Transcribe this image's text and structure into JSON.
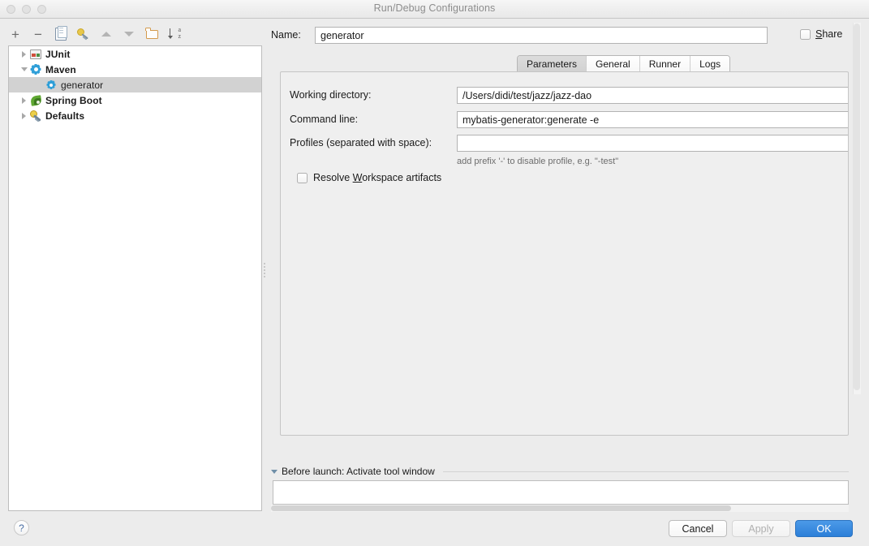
{
  "window": {
    "title": "Run/Debug Configurations"
  },
  "tree_toolbar": {
    "buttons": [
      {
        "name": "add-button",
        "icon": "plus-icon",
        "glyph": "+"
      },
      {
        "name": "remove-button",
        "icon": "minus-icon",
        "glyph": "−"
      },
      {
        "name": "copy-configuration-button",
        "icon": "copy-icon"
      },
      {
        "name": "edit-defaults-button",
        "icon": "wrench-icon"
      },
      {
        "name": "move-up-button",
        "icon": "triangle-up-icon"
      },
      {
        "name": "move-down-button",
        "icon": "triangle-down-icon"
      },
      {
        "name": "new-folder-button",
        "icon": "folder-icon"
      },
      {
        "name": "sort-button",
        "icon": "sort-az-icon"
      }
    ]
  },
  "tree": {
    "items": [
      {
        "label": "JUnit",
        "icon": "junit-icon",
        "expanded": false,
        "selected": false,
        "child": false
      },
      {
        "label": "Maven",
        "icon": "gear-icon",
        "expanded": true,
        "selected": false,
        "child": false
      },
      {
        "label": "generator",
        "icon": "gear-icon",
        "expanded": null,
        "selected": true,
        "child": true
      },
      {
        "label": "Spring Boot",
        "icon": "spring-leaf-icon",
        "expanded": false,
        "selected": false,
        "child": false
      },
      {
        "label": "Defaults",
        "icon": "wrench-icon",
        "expanded": false,
        "selected": false,
        "child": false
      }
    ]
  },
  "name_row": {
    "label": "Name:",
    "value": "generator",
    "placeholder": "",
    "share_label": "Share",
    "share_mnemonic": "S",
    "share_checked": false
  },
  "tabs": [
    {
      "label": "Parameters",
      "active": true
    },
    {
      "label": "General",
      "active": false
    },
    {
      "label": "Runner",
      "active": false
    },
    {
      "label": "Logs",
      "active": false
    }
  ],
  "parameters": {
    "working_directory": {
      "label": "Working directory:",
      "value": "/Users/didi/test/jazz/jazz-dao",
      "placeholder": ""
    },
    "command_line": {
      "label": "Command line:",
      "value": "mybatis-generator:generate -e",
      "placeholder": ""
    },
    "profiles": {
      "label": "Profiles (separated with space):",
      "value": "",
      "placeholder": ""
    },
    "hint": "add prefix '-' to disable profile, e.g. \"-test\"",
    "resolve_workspace": {
      "label_before": "Resolve ",
      "mnemonic": "W",
      "label_after": "orkspace artifacts",
      "checked": false
    }
  },
  "before_launch": {
    "title": "Before launch: Activate tool window",
    "expanded": true,
    "content": ""
  },
  "footer": {
    "help_glyph": "?",
    "cancel_label": "Cancel",
    "apply_label": "Apply",
    "apply_enabled": false,
    "ok_label": "OK",
    "ok_default": true
  },
  "colors": {
    "accent_blue": "#2c7fd8",
    "selection_grey": "#d2d2d2",
    "panel_bg": "#efefef",
    "window_bg": "#ececec"
  }
}
